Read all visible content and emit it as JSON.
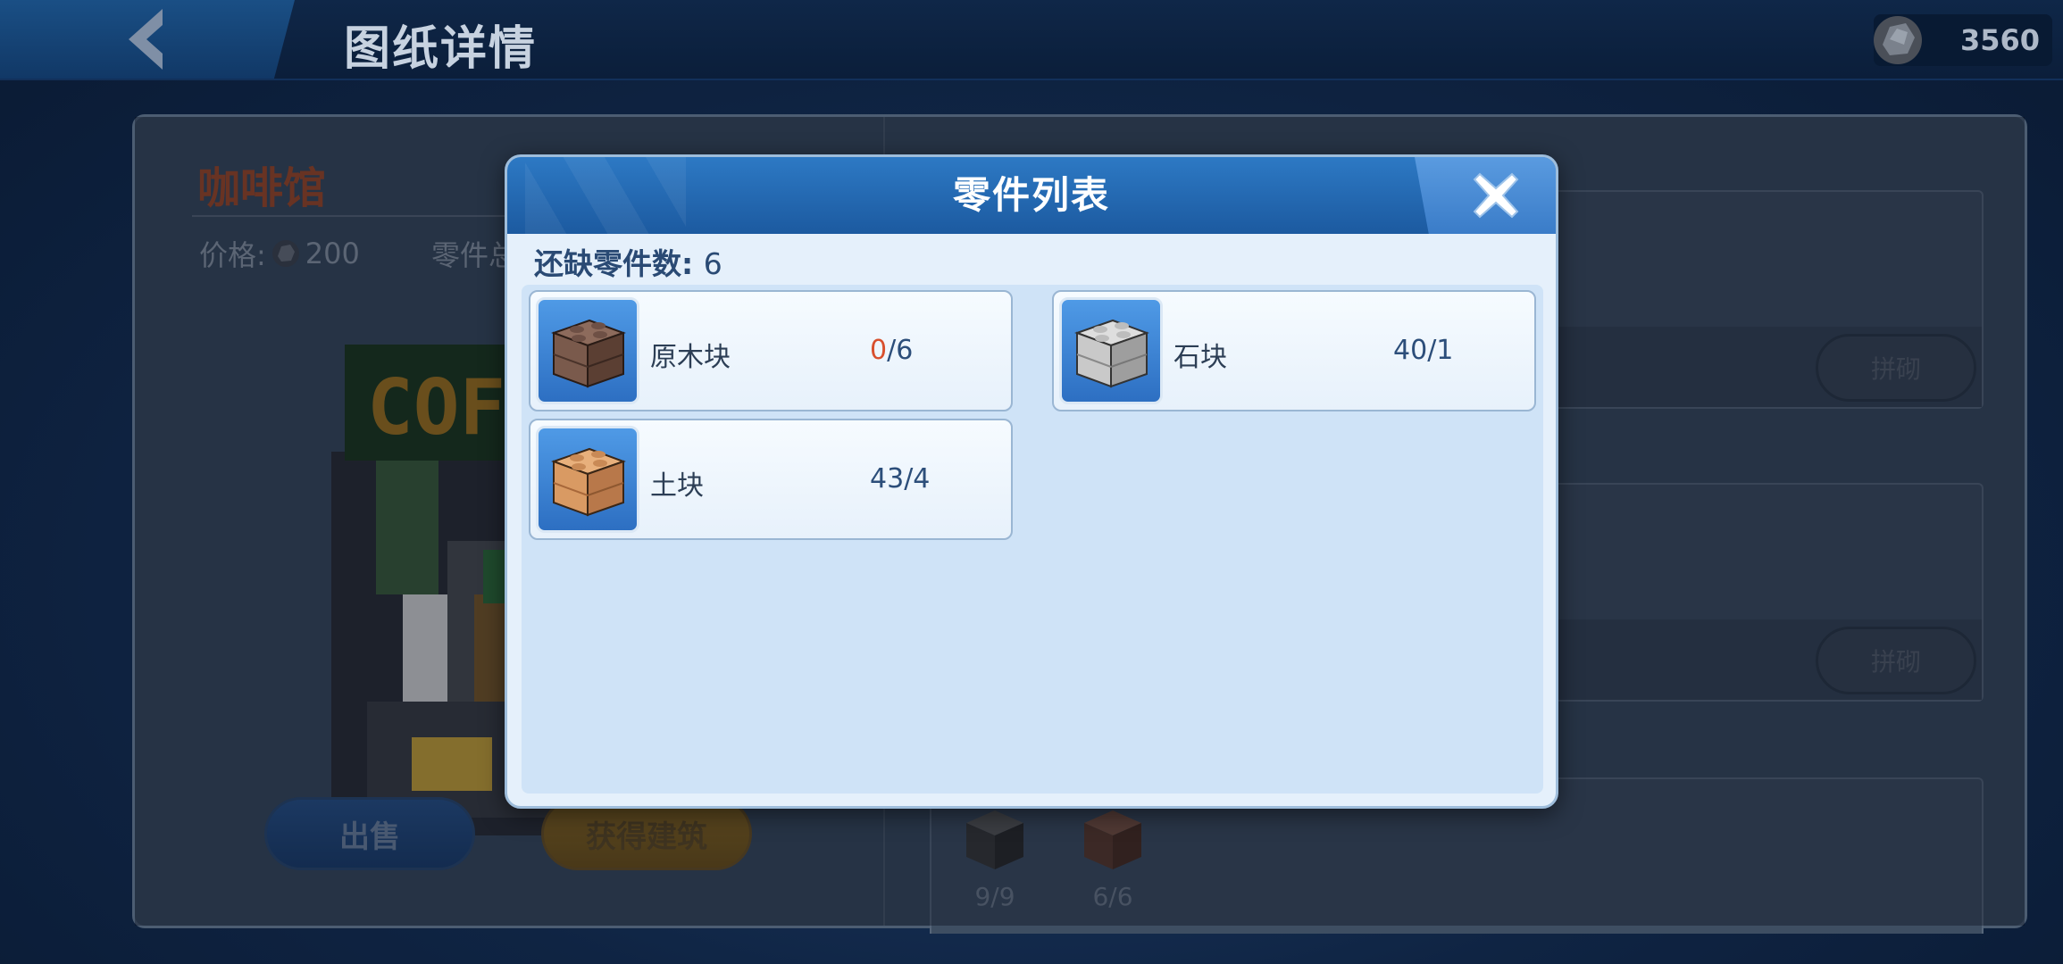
{
  "topbar": {
    "title": "图纸详情",
    "currency_amount": "3560"
  },
  "building": {
    "name": "咖啡馆",
    "price_label": "价格:",
    "price_value": "200",
    "parts_total_label": "零件总",
    "sign_text": "COFF",
    "sell_label": "出售",
    "obtain_label": "获得建筑"
  },
  "requirements": {
    "assemble_label": "拼砌",
    "bottom_parts": [
      {
        "count": "9/9",
        "color": "#3e3e3e"
      },
      {
        "count": "6/6",
        "color": "#6a4636"
      }
    ]
  },
  "dialog": {
    "title": "零件列表",
    "missing_label": "还缺零件数:",
    "missing_count": "6",
    "parts": [
      {
        "name": "原木块",
        "have": "0",
        "need": "6",
        "color": "#7a5a4c",
        "top": "#8d6b5c",
        "side": "#5b3f33"
      },
      {
        "name": "石块",
        "have": "40",
        "need": "1",
        "color": "#c9c9c9",
        "top": "#dedede",
        "side": "#9e9e9e"
      },
      {
        "name": "土块",
        "have": "43",
        "need": "4",
        "color": "#d99a63",
        "top": "#e8b07c",
        "side": "#b8784a"
      }
    ]
  },
  "colors": {
    "accent": "#2d79c4",
    "lack": "#d8502e",
    "background": "#0f2443"
  }
}
